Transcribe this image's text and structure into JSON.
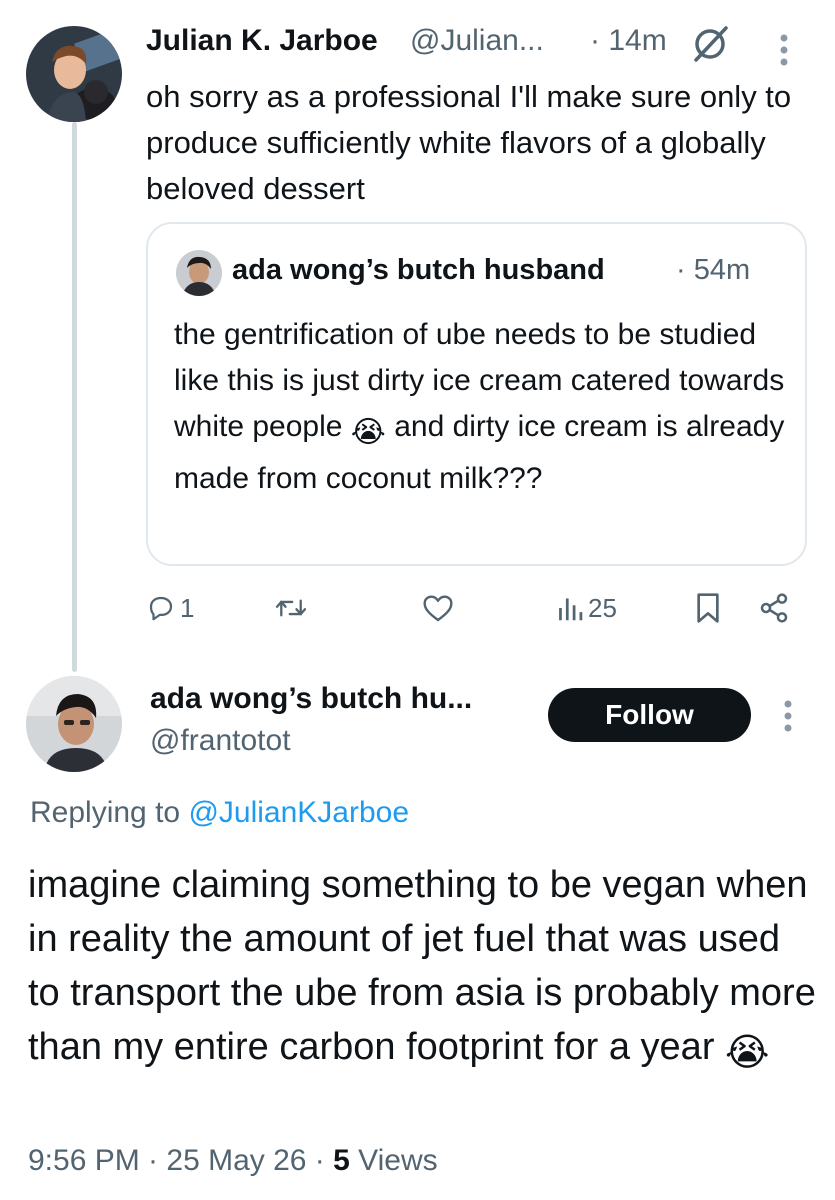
{
  "parent": {
    "author_name": "Julian K. Jarboe",
    "author_handle": "@Julian...",
    "time": "· 14m",
    "text": "oh sorry as a professional I'll make sure only to produce sufficiently white flavors of a globally beloved dessert",
    "icons": {
      "grok": "grok-slash-circle-icon",
      "more": "more-vertical-icon"
    },
    "quote": {
      "author_name": "ada wong’s butch husband",
      "time": "· 54m",
      "text_before_emoji": "the gentrification of ube needs to be studied like this is just dirty ice cream catered towards white people ",
      "emoji": "😭",
      "text_after_emoji": " and dirty ice cream is already made from coconut milk???"
    },
    "actions": {
      "reply_count": "1",
      "views_count": "25",
      "icons": [
        "reply-icon",
        "retweet-icon",
        "like-icon",
        "views-icon",
        "bookmark-icon",
        "share-icon"
      ]
    }
  },
  "main": {
    "author_name": "ada wong’s butch hu...",
    "author_handle": "@frantotot",
    "follow_label": "Follow",
    "replying_prefix": "Replying to ",
    "replying_handle": "@JulianKJarboe",
    "text": "imagine claiming something to be vegan when in reality the amount of jet fuel that was used to transport the ube from asia is probably more than my entire carbon footprint for a year ",
    "emoji": "😭",
    "timestamp": "9:56 PM · 25 May 26 · ",
    "views_count": "5",
    "views_label": " Views"
  },
  "colors": {
    "text": "#0f1419",
    "secondary": "#536471",
    "link": "#1d9bf0",
    "border": "#e1e8ed",
    "thread_line": "#cfd9de",
    "button_bg": "#0f1419"
  }
}
